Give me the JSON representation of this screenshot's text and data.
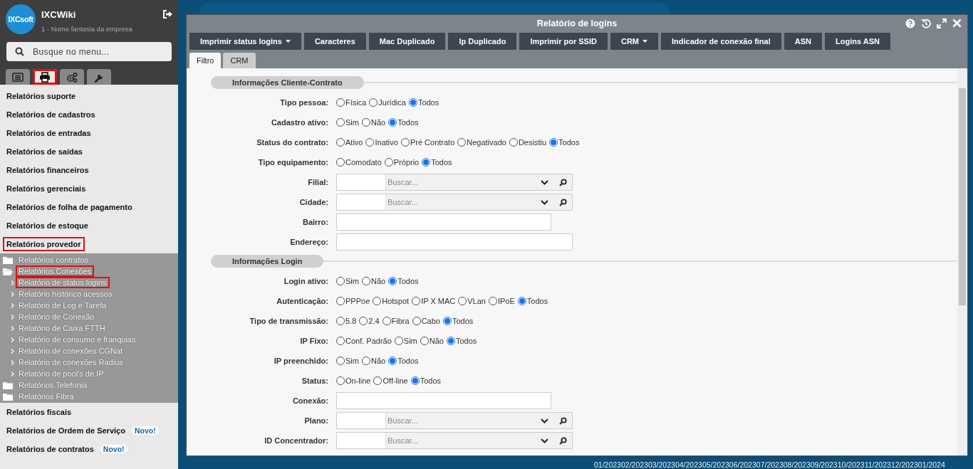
{
  "sidebar": {
    "logo": "IXCsoft",
    "app_name": "IXCWiki",
    "company": "1 - Nome fantasia da empresa",
    "search": {
      "placeholder": "Busque no menu..."
    },
    "tabs": [
      {
        "selected": false,
        "highlighted": false
      },
      {
        "selected": true,
        "highlighted": true
      },
      {
        "selected": false,
        "highlighted": false
      },
      {
        "selected": false,
        "highlighted": false
      }
    ],
    "menu": [
      {
        "label": "Relatórios suporte",
        "highlighted": false
      },
      {
        "label": "Relatórios de cadastros",
        "highlighted": false
      },
      {
        "label": "Relatórios de entradas",
        "highlighted": false
      },
      {
        "label": "Relatórios de saídas",
        "highlighted": false
      },
      {
        "label": "Relatórios financeiros",
        "highlighted": false
      },
      {
        "label": "Relatórios gerenciais",
        "highlighted": false
      },
      {
        "label": "Relatórios de folha de pagamento",
        "highlighted": false
      },
      {
        "label": "Relatórios de estoque",
        "highlighted": false
      },
      {
        "label": "Relatórios provedor",
        "highlighted": true,
        "expanded": true,
        "children": [
          {
            "label": "Relatórios contratos",
            "expanded": false,
            "highlighted": false
          },
          {
            "label": "Relatórios Conexões",
            "expanded": true,
            "highlighted": true,
            "children": [
              {
                "label": "Relatório de status logins",
                "highlighted": true
              },
              {
                "label": "Relatório histórico acessos",
                "highlighted": false
              },
              {
                "label": "Relatório de Log e Tarefa",
                "highlighted": false
              },
              {
                "label": "Relatório de Conexão",
                "highlighted": false
              },
              {
                "label": "Relatório de Caixa FTTH",
                "highlighted": false
              },
              {
                "label": "Relatório de consumo e franquias",
                "highlighted": false
              },
              {
                "label": "Relatório de conexões CGNat",
                "highlighted": false
              },
              {
                "label": "Relatório de conexões Radius",
                "highlighted": false
              },
              {
                "label": "Relatório de pool's de IP",
                "highlighted": false
              }
            ]
          },
          {
            "label": "Relatórios Telefonia",
            "expanded": false,
            "highlighted": false
          },
          {
            "label": "Relatórios Fibra",
            "expanded": false,
            "highlighted": false
          }
        ]
      },
      {
        "label": "Relatórios fiscais",
        "highlighted": false
      },
      {
        "label": "Relatórios de Ordem de Serviço",
        "highlighted": false,
        "badge": "Novo!"
      },
      {
        "label": "Relatórios de contratos",
        "highlighted": false,
        "badge": "Novo!"
      }
    ]
  },
  "background": {
    "axis_labels": [
      "01/2023",
      "02/2023",
      "03/2023",
      "04/2023",
      "05/2023",
      "06/2023",
      "07/2023",
      "08/2023",
      "09/2023",
      "10/2023",
      "11/2023",
      "12/2023",
      "01/2024"
    ]
  },
  "window": {
    "title": "Relatório de logins",
    "toolbar": [
      {
        "label": "Imprimir status logins",
        "dropdown": true
      },
      {
        "label": "Caracteres",
        "dropdown": false
      },
      {
        "label": "Mac Duplicado",
        "dropdown": false
      },
      {
        "label": "Ip Duplicado",
        "dropdown": false
      },
      {
        "label": "Imprimir por SSID",
        "dropdown": false
      },
      {
        "label": "CRM",
        "dropdown": true
      },
      {
        "label": "Indicador de conexão final",
        "dropdown": false
      },
      {
        "label": "ASN",
        "dropdown": false
      },
      {
        "label": "Logins ASN",
        "dropdown": false
      }
    ],
    "tabs": [
      {
        "label": "Filtro",
        "selected": true
      },
      {
        "label": "CRM",
        "selected": false
      }
    ],
    "sections": [
      {
        "title": "Informações Cliente-Contrato",
        "rows": [
          {
            "kind": "radio",
            "label": "Tipo pessoa:",
            "options": [
              {
                "label": "Física",
                "selected": false
              },
              {
                "label": "Jurídica",
                "selected": false
              },
              {
                "label": "Todos",
                "selected": true
              }
            ]
          },
          {
            "kind": "radio",
            "label": "Cadastro ativo:",
            "options": [
              {
                "label": "Sim",
                "selected": false
              },
              {
                "label": "Não",
                "selected": false
              },
              {
                "label": "Todos",
                "selected": true
              }
            ]
          },
          {
            "kind": "radio",
            "label": "Status do contrato:",
            "options": [
              {
                "label": "Ativo",
                "selected": false
              },
              {
                "label": "Inativo",
                "selected": false
              },
              {
                "label": "Pré Contrato",
                "selected": false
              },
              {
                "label": "Negativado",
                "selected": false
              },
              {
                "label": "Desistiu",
                "selected": false
              },
              {
                "label": "Todos",
                "selected": true
              }
            ]
          },
          {
            "kind": "radio",
            "label": "Tipo equipamento:",
            "options": [
              {
                "label": "Comodato",
                "selected": false
              },
              {
                "label": "Próprio",
                "selected": false
              },
              {
                "label": "Todos",
                "selected": true
              }
            ]
          },
          {
            "kind": "lookup",
            "label": "Filial:",
            "placeholder": "Buscar..."
          },
          {
            "kind": "lookup",
            "label": "Cidade:",
            "placeholder": "Buscar..."
          },
          {
            "kind": "text",
            "label": "Bairro:"
          },
          {
            "kind": "wide_text",
            "label": "Endereço:"
          }
        ]
      },
      {
        "title": "Informações Login",
        "rows": [
          {
            "kind": "radio",
            "label": "Login ativo:",
            "options": [
              {
                "label": "Sim",
                "selected": false
              },
              {
                "label": "Não",
                "selected": false
              },
              {
                "label": "Todos",
                "selected": true
              }
            ]
          },
          {
            "kind": "radio",
            "label": "Autenticação:",
            "options": [
              {
                "label": "PPPoe",
                "selected": false
              },
              {
                "label": "Hotspot",
                "selected": false
              },
              {
                "label": "IP X MAC",
                "selected": false
              },
              {
                "label": "VLan",
                "selected": false
              },
              {
                "label": "IPoE",
                "selected": false
              },
              {
                "label": "Todos",
                "selected": true
              }
            ]
          },
          {
            "kind": "radio",
            "label": "Tipo de transmissão:",
            "options": [
              {
                "label": "5.8",
                "selected": false
              },
              {
                "label": "2.4",
                "selected": false
              },
              {
                "label": "Fibra",
                "selected": false
              },
              {
                "label": "Cabo",
                "selected": false
              },
              {
                "label": "Todos",
                "selected": true
              }
            ]
          },
          {
            "kind": "radio",
            "label": "IP Fixo:",
            "options": [
              {
                "label": "Conf. Padrão",
                "selected": false
              },
              {
                "label": "Sim",
                "selected": false
              },
              {
                "label": "Não",
                "selected": false
              },
              {
                "label": "Todos",
                "selected": true
              }
            ]
          },
          {
            "kind": "radio",
            "label": "IP preenchido:",
            "options": [
              {
                "label": "Sim",
                "selected": false
              },
              {
                "label": "Não",
                "selected": false
              },
              {
                "label": "Todos",
                "selected": true
              }
            ]
          },
          {
            "kind": "radio",
            "label": "Status:",
            "options": [
              {
                "label": "On-line",
                "selected": false
              },
              {
                "label": "Off-line",
                "selected": false
              },
              {
                "label": "Todos",
                "selected": true
              }
            ]
          },
          {
            "kind": "text",
            "label": "Conexão:"
          },
          {
            "kind": "lookup",
            "label": "Plano:",
            "placeholder": "Buscar..."
          },
          {
            "kind": "lookup",
            "label": "ID Concentrador:",
            "placeholder": "Buscar..."
          }
        ]
      }
    ]
  }
}
